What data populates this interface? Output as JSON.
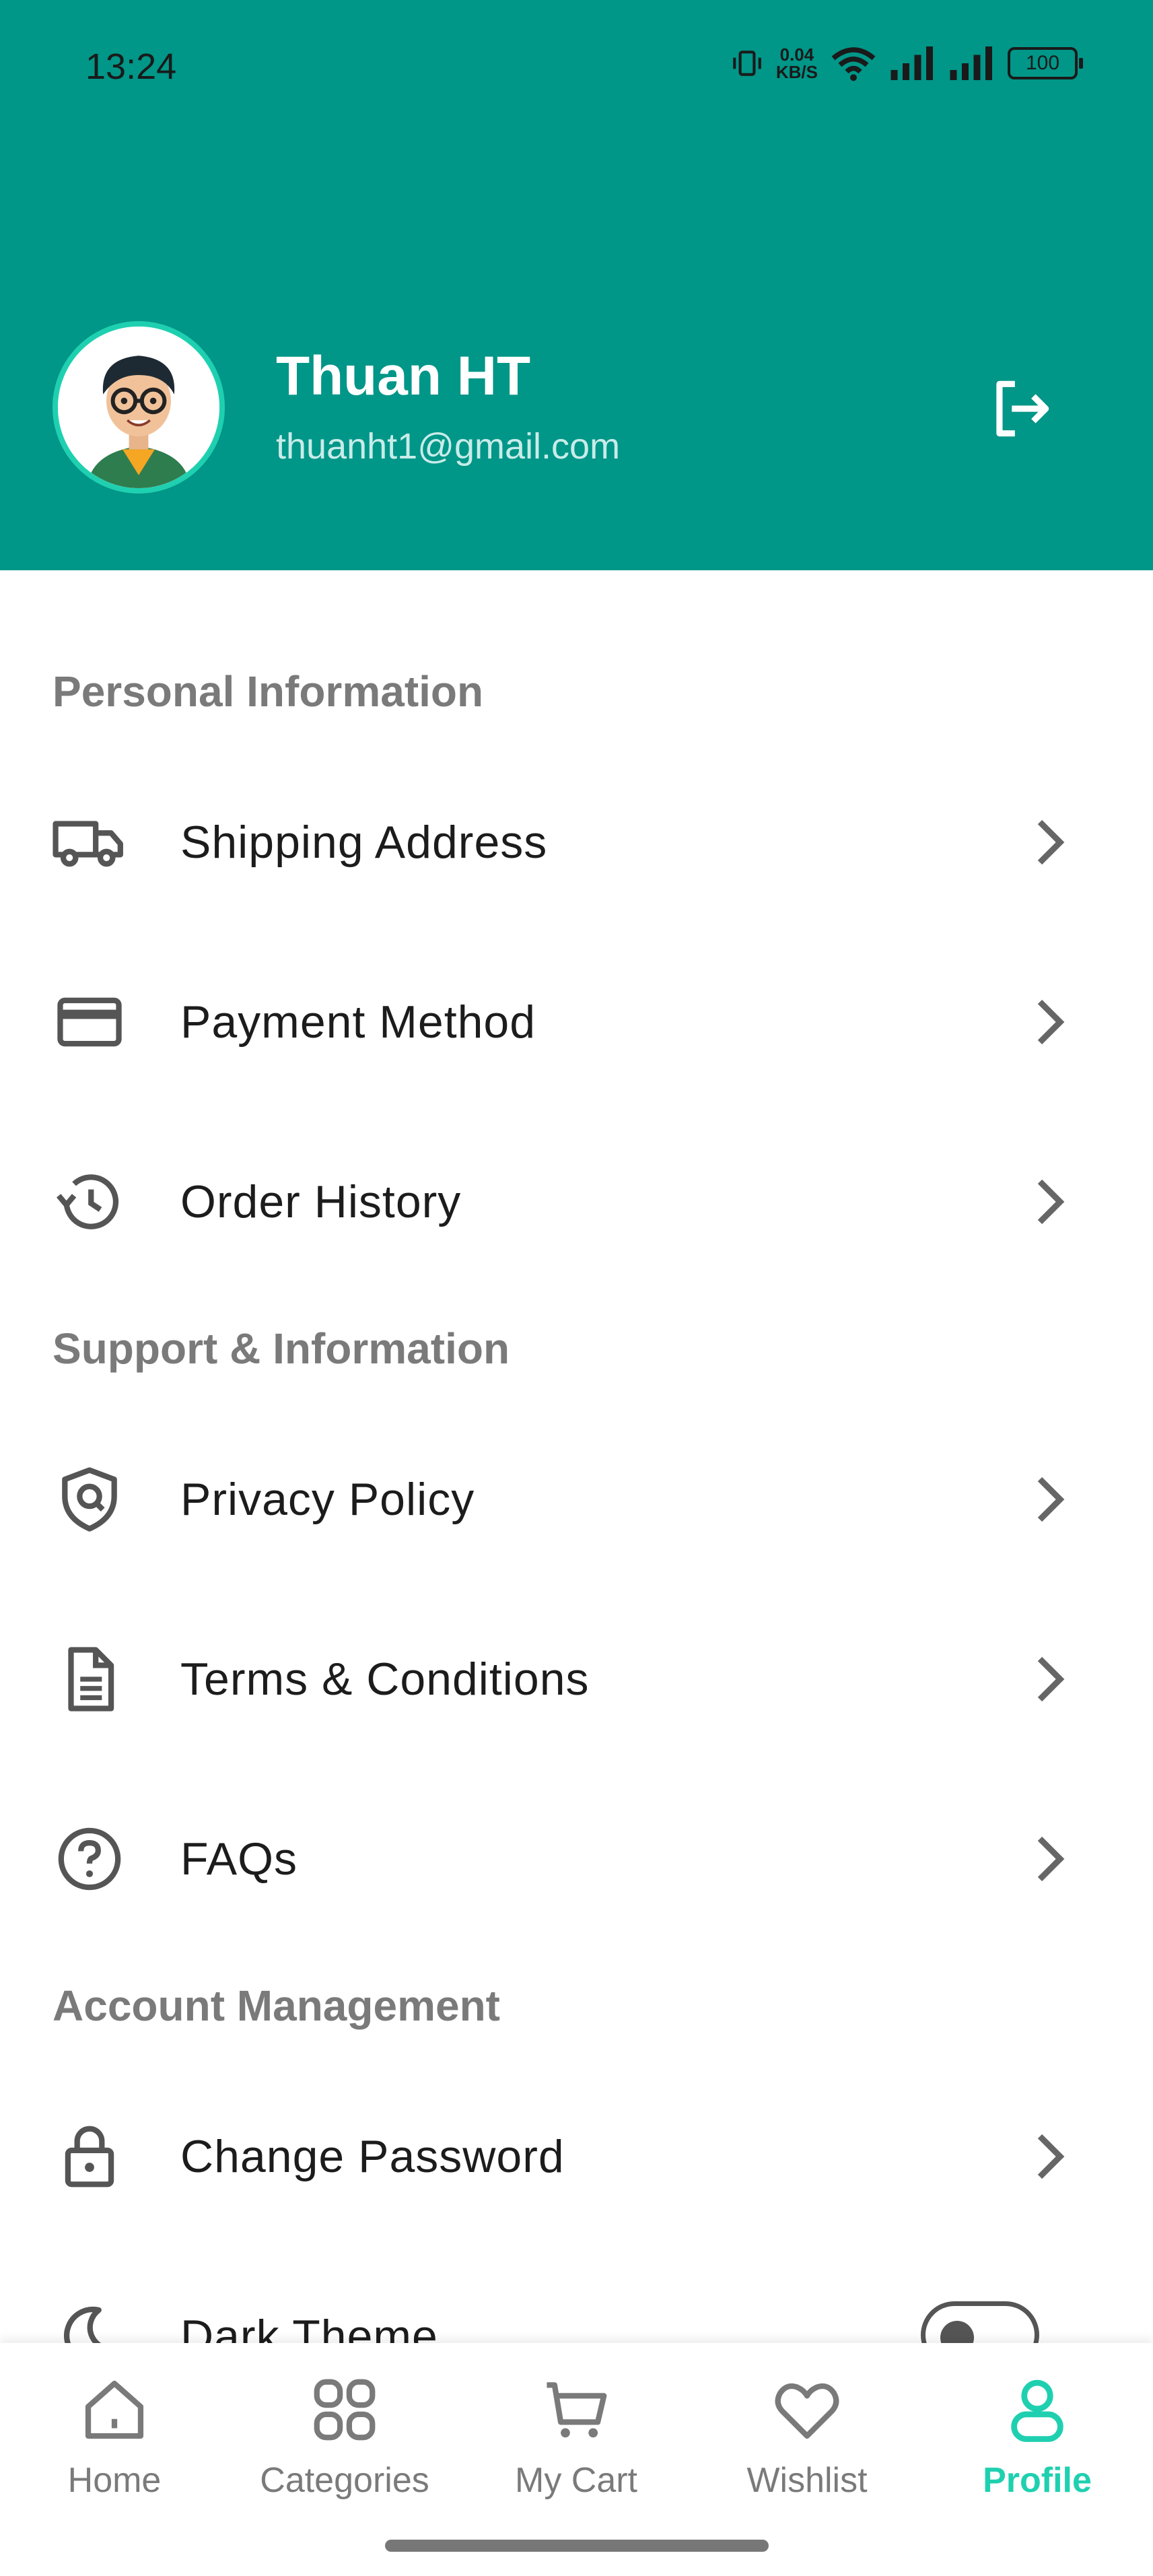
{
  "status_bar": {
    "time": "13:24",
    "net_speed_value": "0.04",
    "net_speed_unit": "KB/S",
    "battery": "100"
  },
  "profile": {
    "name": "Thuan HT",
    "email": "thuanht1@gmail.com"
  },
  "sections": {
    "personal": {
      "title": "Personal Information",
      "items": [
        {
          "label": "Shipping Address",
          "icon": "truck-icon"
        },
        {
          "label": "Payment Method",
          "icon": "credit-card-icon"
        },
        {
          "label": "Order History",
          "icon": "history-icon"
        }
      ]
    },
    "support": {
      "title": "Support & Information",
      "items": [
        {
          "label": "Privacy Policy",
          "icon": "shield-icon"
        },
        {
          "label": "Terms & Conditions",
          "icon": "document-icon"
        },
        {
          "label": "FAQs",
          "icon": "help-circle-icon"
        }
      ]
    },
    "account": {
      "title": "Account Management",
      "items": [
        {
          "label": "Change Password",
          "icon": "lock-icon"
        },
        {
          "label": "Dark Theme",
          "icon": "moon-icon",
          "toggle_on": false
        }
      ]
    }
  },
  "bottom_nav": {
    "items": [
      {
        "label": "Home",
        "icon": "home-icon"
      },
      {
        "label": "Categories",
        "icon": "grid-icon"
      },
      {
        "label": "My Cart",
        "icon": "cart-icon"
      },
      {
        "label": "Wishlist",
        "icon": "heart-icon"
      },
      {
        "label": "Profile",
        "icon": "user-icon"
      }
    ],
    "active_index": 4
  },
  "colors": {
    "header": "#009688",
    "accent": "#1fd0b0",
    "inactive": "#7a7a7a"
  }
}
